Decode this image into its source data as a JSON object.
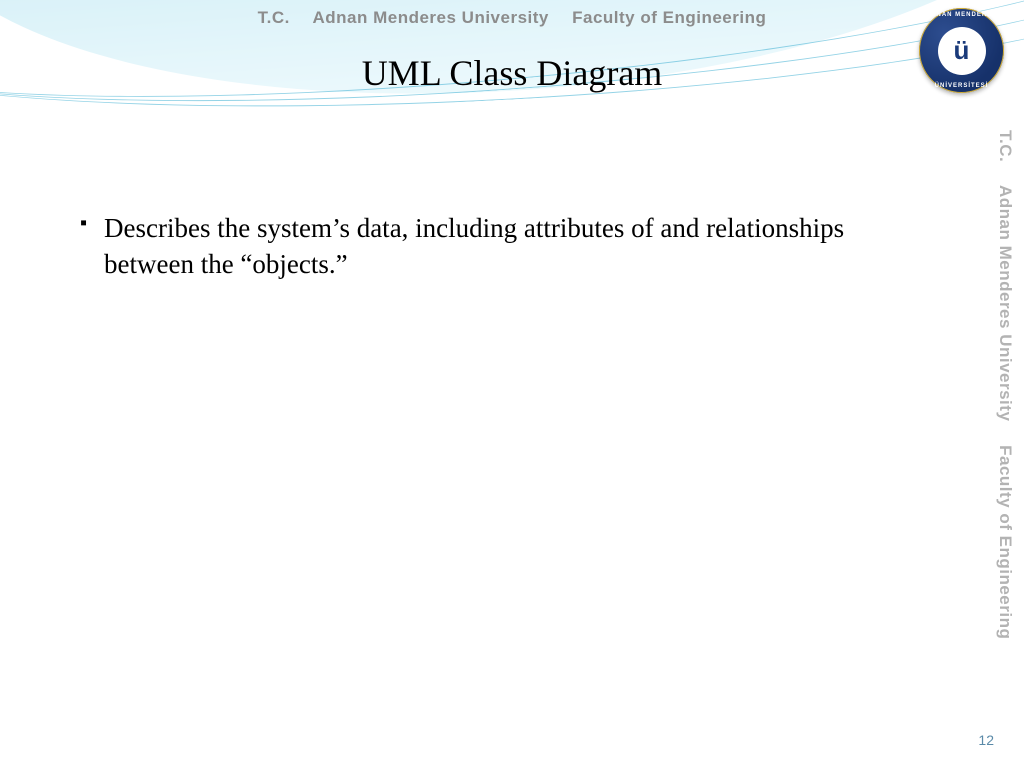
{
  "header": {
    "tc": "T.C.",
    "university": "Adnan Menderes University",
    "faculty": "Faculty of Engineering"
  },
  "logo": {
    "inner_letter": "ü",
    "ring_top": "ADNAN MENDERES",
    "ring_bottom": "ÜNİVERSİTESİ"
  },
  "sidebar": {
    "tc": "T.C.",
    "university": "Adnan Menderes University",
    "faculty": "Faculty of Engineering"
  },
  "slide": {
    "title": "UML Class Diagram",
    "bullets": [
      "Describes the system’s data, including attributes of and relationships between the “objects.”"
    ]
  },
  "page_number": "12"
}
